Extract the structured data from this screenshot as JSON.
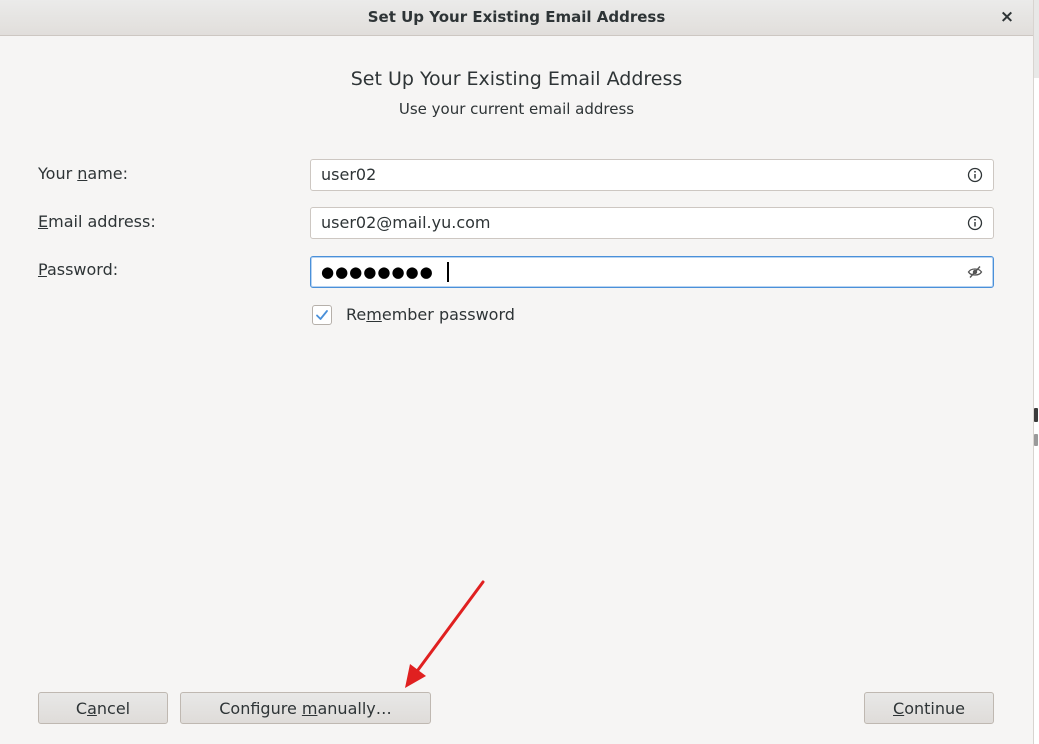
{
  "window": {
    "title": "Set Up Your Existing Email Address",
    "close_glyph": "×"
  },
  "header": {
    "title": "Set Up Your Existing Email Address",
    "subtitle": "Use your current email address"
  },
  "form": {
    "name": {
      "label_pre": "Your ",
      "label_mnemonic": "n",
      "label_post": "ame:",
      "value": "user02",
      "icon": "info-icon"
    },
    "email": {
      "label_pre": "",
      "label_mnemonic": "E",
      "label_post": "mail address:",
      "value": "user02@mail.yu.com",
      "icon": "info-icon"
    },
    "password": {
      "label_pre": "",
      "label_mnemonic": "P",
      "label_post": "assword:",
      "masked_value": "●●●●●●●●",
      "icon": "eye-slash-icon"
    },
    "remember": {
      "label_pre": "Re",
      "label_mnemonic": "m",
      "label_post": "ember password",
      "checked": true
    }
  },
  "buttons": {
    "cancel": {
      "pre": "C",
      "mnemonic": "a",
      "post": "ncel"
    },
    "configure": {
      "pre": "Configure ",
      "mnemonic": "m",
      "post": "anually…"
    },
    "continue": {
      "pre": "",
      "mnemonic": "C",
      "post": "ontinue"
    }
  },
  "colors": {
    "focus_border": "#4a90d9",
    "checkbox_check": "#4a90d9",
    "annotation_arrow": "#e02020"
  }
}
